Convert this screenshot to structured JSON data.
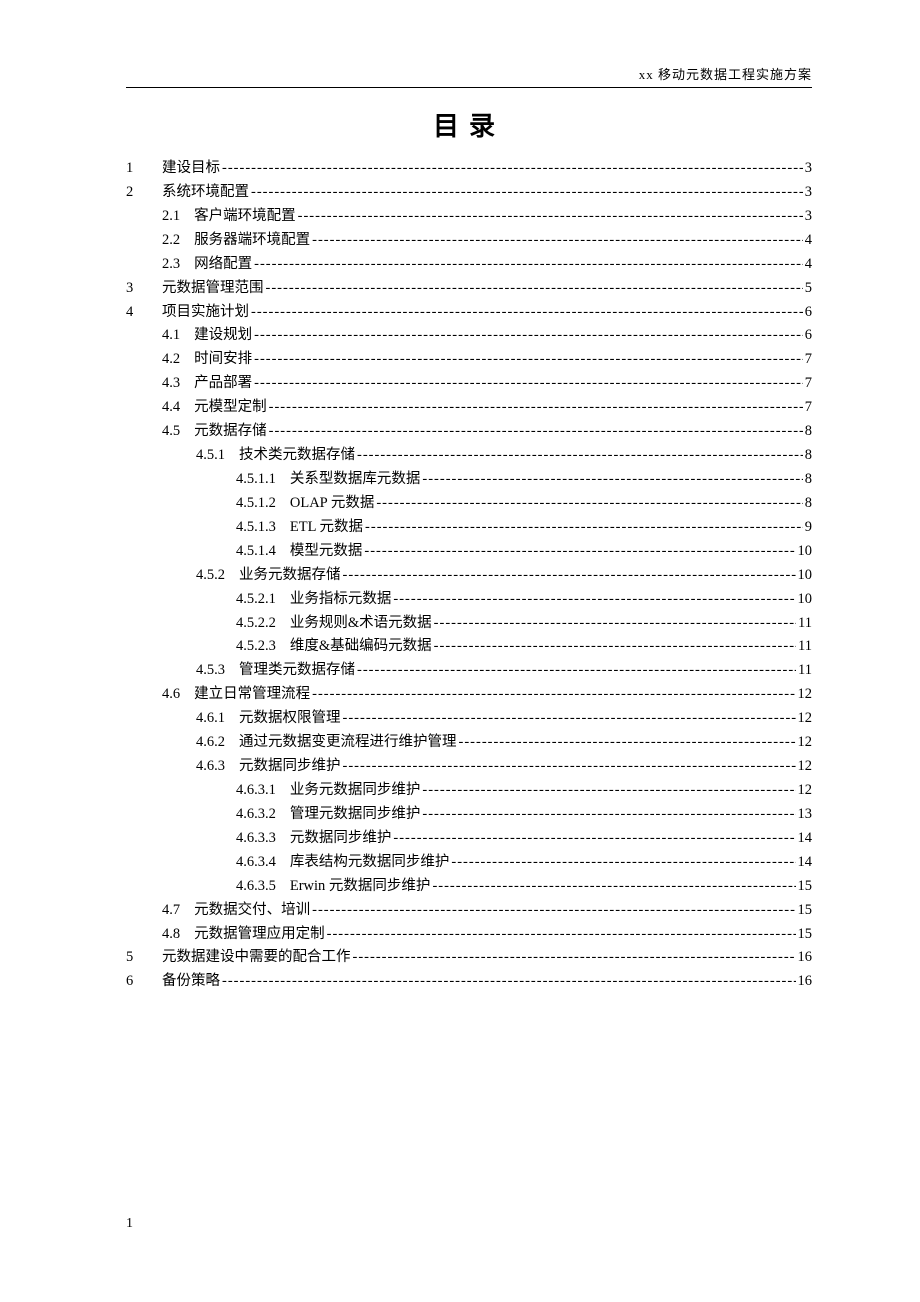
{
  "header": {
    "running": "xx 移动元数据工程实施方案"
  },
  "title": "目录",
  "footer_page": "1",
  "toc": [
    {
      "level": 0,
      "top": "1",
      "num": "",
      "title": "建设目标",
      "page": "3"
    },
    {
      "level": 0,
      "top": "2",
      "num": "",
      "title": "系统环境配置",
      "page": "3"
    },
    {
      "level": 1,
      "top": "",
      "num": "2.1",
      "title": "客户端环境配置 ",
      "page": "3"
    },
    {
      "level": 1,
      "top": "",
      "num": "2.2",
      "title": "服务器端环境配置 ",
      "page": "4"
    },
    {
      "level": 1,
      "top": "",
      "num": "2.3",
      "title": "网络配置 ",
      "page": "4"
    },
    {
      "level": 0,
      "top": "3",
      "num": "",
      "title": "元数据管理范围",
      "page": "5"
    },
    {
      "level": 0,
      "top": "4",
      "num": "",
      "title": "项目实施计划",
      "page": "6"
    },
    {
      "level": 1,
      "top": "",
      "num": "4.1",
      "title": "建设规划 ",
      "page": "6"
    },
    {
      "level": 1,
      "top": "",
      "num": "4.2",
      "title": "时间安排 ",
      "page": "7"
    },
    {
      "level": 1,
      "top": "",
      "num": "4.3",
      "title": "产品部署 ",
      "page": "7"
    },
    {
      "level": 1,
      "top": "",
      "num": "4.4",
      "title": "元模型定制 ",
      "page": "7"
    },
    {
      "level": 1,
      "top": "",
      "num": "4.5",
      "title": "元数据存储 ",
      "page": "8"
    },
    {
      "level": 2,
      "top": "",
      "num": "4.5.1",
      "title": "技术类元数据存储",
      "page": "8"
    },
    {
      "level": 3,
      "top": "",
      "num": "4.5.1.1",
      "title": "关系型数据库元数据",
      "page": "8"
    },
    {
      "level": 3,
      "top": "",
      "num": "4.5.1.2",
      "title": "OLAP 元数据 ",
      "page": "8"
    },
    {
      "level": 3,
      "top": "",
      "num": "4.5.1.3",
      "title": "ETL 元数据 ",
      "page": "9"
    },
    {
      "level": 3,
      "top": "",
      "num": "4.5.1.4",
      "title": "模型元数据 ",
      "page": "10"
    },
    {
      "level": 2,
      "top": "",
      "num": "4.5.2",
      "title": "业务元数据存储 ",
      "page": "10"
    },
    {
      "level": 3,
      "top": "",
      "num": "4.5.2.1",
      "title": "业务指标元数据 ",
      "page": "10"
    },
    {
      "level": 3,
      "top": "",
      "num": "4.5.2.2",
      "title": "业务规则&术语元数据",
      "page": "11"
    },
    {
      "level": 3,
      "top": "",
      "num": "4.5.2.3",
      "title": "维度&基础编码元数据",
      "page": "11"
    },
    {
      "level": 2,
      "top": "",
      "num": "4.5.3",
      "title": "管理类元数据存储 ",
      "page": "11"
    },
    {
      "level": 1,
      "top": "",
      "num": "4.6",
      "title": "建立日常管理流程",
      "page": "12"
    },
    {
      "level": 2,
      "top": "",
      "num": "4.6.1",
      "title": "元数据权限管理 ",
      "page": "12"
    },
    {
      "level": 2,
      "top": "",
      "num": "4.6.2",
      "title": "通过元数据变更流程进行维护管理 ",
      "page": "12"
    },
    {
      "level": 2,
      "top": "",
      "num": "4.6.3",
      "title": "元数据同步维护 ",
      "page": "12"
    },
    {
      "level": 3,
      "top": "",
      "num": "4.6.3.1",
      "title": "业务元数据同步维护 ",
      "page": "12"
    },
    {
      "level": 3,
      "top": "",
      "num": "4.6.3.2",
      "title": "管理元数据同步维护 ",
      "page": "13"
    },
    {
      "level": 3,
      "top": "",
      "num": "4.6.3.3",
      "title": "元数据同步维护 ",
      "page": "14"
    },
    {
      "level": 3,
      "top": "",
      "num": "4.6.3.4",
      "title": "库表结构元数据同步维护 ",
      "page": "14"
    },
    {
      "level": 3,
      "top": "",
      "num": "4.6.3.5",
      "title": "Erwin 元数据同步维护 ",
      "page": "15"
    },
    {
      "level": 1,
      "top": "",
      "num": "4.7",
      "title": "元数据交付、培训",
      "page": "15"
    },
    {
      "level": 1,
      "top": "",
      "num": "4.8",
      "title": "元数据管理应用定制",
      "page": "15"
    },
    {
      "level": 0,
      "top": "5",
      "num": "",
      "title": "元数据建设中需要的配合工作 ",
      "page": "16"
    },
    {
      "level": 0,
      "top": "6",
      "num": "",
      "title": "备份策略 ",
      "page": "16"
    }
  ]
}
